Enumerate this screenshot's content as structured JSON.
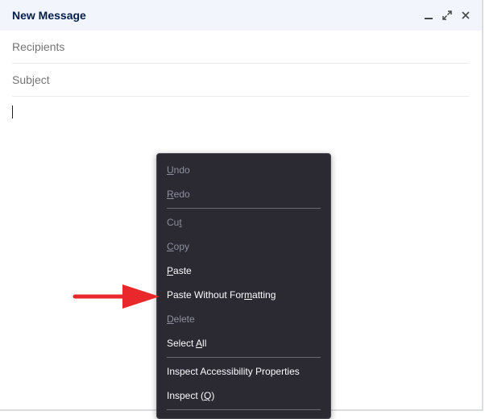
{
  "window": {
    "title": "New Message",
    "controls": [
      "minimize-icon",
      "expand-icon",
      "close-icon"
    ]
  },
  "fields": {
    "recipients_placeholder": "Recipients",
    "subject_placeholder": "Subject"
  },
  "context_menu": {
    "groups": [
      [
        {
          "prefix": "",
          "mnemonic": "U",
          "rest": "ndo",
          "enabled": false
        },
        {
          "prefix": "",
          "mnemonic": "R",
          "rest": "edo",
          "enabled": false
        }
      ],
      [
        {
          "prefix": "Cu",
          "mnemonic": "t",
          "rest": "",
          "enabled": false
        },
        {
          "prefix": "",
          "mnemonic": "C",
          "rest": "opy",
          "enabled": false
        },
        {
          "prefix": "",
          "mnemonic": "P",
          "rest": "aste",
          "enabled": true
        },
        {
          "prefix": "Paste Without For",
          "mnemonic": "m",
          "rest": "atting",
          "enabled": true
        },
        {
          "prefix": "",
          "mnemonic": "D",
          "rest": "elete",
          "enabled": false
        },
        {
          "prefix": "Select ",
          "mnemonic": "A",
          "rest": "ll",
          "enabled": true
        }
      ],
      [
        {
          "prefix": "Inspect Accessibility Properties",
          "mnemonic": "",
          "rest": "",
          "enabled": true
        },
        {
          "prefix": "Inspect (",
          "mnemonic": "Q",
          "rest": ")",
          "enabled": true
        }
      ]
    ]
  },
  "colors": {
    "header_bg": "#f2f6fc",
    "menu_bg": "#2b2a33",
    "arrow": "#e8282b"
  }
}
